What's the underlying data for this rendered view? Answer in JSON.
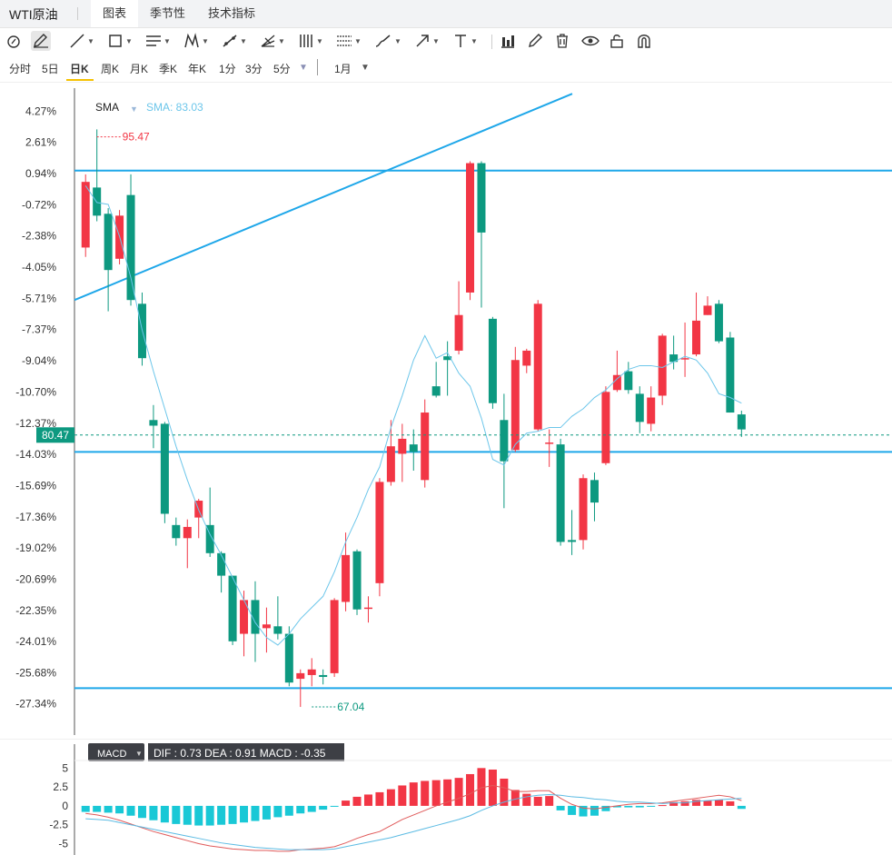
{
  "header": {
    "title": "WTI原油",
    "tabs": [
      {
        "label": "图表",
        "active": true
      },
      {
        "label": "季节性",
        "active": false
      },
      {
        "label": "技术指标",
        "active": false
      }
    ]
  },
  "toolbar": {
    "tools": [
      "cursor-icon",
      "pen-icon",
      "line-icon",
      "rectangle-icon",
      "channel-icon",
      "pattern-icon",
      "fib-icon",
      "gann-icon",
      "hlines-icon",
      "grid-lines-icon",
      "brush-icon",
      "arrow-icon",
      "text-icon",
      "bar-chart-icon",
      "edit-icon",
      "trash-icon",
      "eye-icon",
      "lock-icon",
      "magnet-icon"
    ]
  },
  "periods": {
    "items": [
      "分时",
      "5日",
      "日K",
      "周K",
      "月K",
      "季K",
      "年K",
      "1分",
      "3分",
      "5分"
    ],
    "active": "日K",
    "range": "1月"
  },
  "chart_data": {
    "type": "candlestick",
    "indicator_label": "SMA",
    "sma_readout": "SMA: 83.03",
    "y_axis_ticks": [
      "4.27%",
      "2.61%",
      "0.94%",
      "-0.72%",
      "-2.38%",
      "-4.05%",
      "-5.71%",
      "-7.37%",
      "-9.04%",
      "-10.70%",
      "-12.37%",
      "-14.03%",
      "-15.69%",
      "-17.36%",
      "-19.02%",
      "-20.69%",
      "-22.35%",
      "-24.01%",
      "-25.68%",
      "-27.34%"
    ],
    "y_range_pct": [
      -29.0,
      5.5
    ],
    "current_price": "80.47",
    "current_price_pct": -13.0,
    "high_label": "95.47",
    "high_pct": 2.9,
    "low_label": "67.04",
    "low_pct": -27.5,
    "candles": [
      {
        "o": -3.0,
        "c": 0.5,
        "h": 0.9,
        "l": -3.5
      },
      {
        "o": 0.2,
        "c": -1.3,
        "h": 3.3,
        "l": -1.6
      },
      {
        "o": -1.2,
        "c": -4.2,
        "h": -0.9,
        "l": -6.4
      },
      {
        "o": -3.6,
        "c": -1.3,
        "h": -1.0,
        "l": -3.9
      },
      {
        "o": -0.2,
        "c": -5.8,
        "h": 0.9,
        "l": -6.1
      },
      {
        "o": -6.0,
        "c": -8.9,
        "h": -5.4,
        "l": -9.3
      },
      {
        "o": -12.2,
        "c": -12.5,
        "h": -11.4,
        "l": -13.7
      },
      {
        "o": -12.4,
        "c": -17.2,
        "h": -12.3,
        "l": -17.7
      },
      {
        "o": -17.8,
        "c": -18.5,
        "h": -17.4,
        "l": -18.9
      },
      {
        "o": -18.5,
        "c": -17.9,
        "h": -17.5,
        "l": -20.1
      },
      {
        "o": -17.4,
        "c": -16.5,
        "h": -16.4,
        "l": -18.5
      },
      {
        "o": -17.8,
        "c": -19.3,
        "h": -15.8,
        "l": -19.5
      },
      {
        "o": -19.3,
        "c": -20.5,
        "h": -19.2,
        "l": -21.4
      },
      {
        "o": -20.5,
        "c": -24.0,
        "h": -20.5,
        "l": -24.2
      },
      {
        "o": -23.6,
        "c": -21.8,
        "h": -21.3,
        "l": -24.8
      },
      {
        "o": -21.8,
        "c": -23.6,
        "h": -20.8,
        "l": -25.1
      },
      {
        "o": -23.3,
        "c": -23.1,
        "h": -22.2,
        "l": -24.6
      },
      {
        "o": -23.2,
        "c": -23.6,
        "h": -21.6,
        "l": -23.9
      },
      {
        "o": -23.6,
        "c": -26.2,
        "h": -23.2,
        "l": -26.4
      },
      {
        "o": -26.0,
        "c": -25.7,
        "h": -25.5,
        "l": -27.5
      },
      {
        "o": -25.8,
        "c": -25.5,
        "h": -24.9,
        "l": -26.4
      },
      {
        "o": -25.8,
        "c": -25.9,
        "h": -25.5,
        "l": -26.3
      },
      {
        "o": -25.7,
        "c": -21.8,
        "h": -21.7,
        "l": -25.9
      },
      {
        "o": -21.9,
        "c": -19.4,
        "h": -18.2,
        "l": -22.4
      },
      {
        "o": -19.2,
        "c": -22.3,
        "h": -19.1,
        "l": -22.6
      },
      {
        "o": -22.2,
        "c": -22.2,
        "h": -21.6,
        "l": -23.0
      },
      {
        "o": -20.9,
        "c": -15.5,
        "h": -15.3,
        "l": -21.6
      },
      {
        "o": -15.5,
        "c": -13.6,
        "h": -12.2,
        "l": -15.7
      },
      {
        "o": -14.0,
        "c": -13.2,
        "h": -12.4,
        "l": -15.5
      },
      {
        "o": -13.5,
        "c": -13.9,
        "h": -12.7,
        "l": -14.9
      },
      {
        "o": -15.4,
        "c": -11.8,
        "h": -11.1,
        "l": -15.8
      },
      {
        "o": -10.4,
        "c": -10.9,
        "h": -9.1,
        "l": -11.0
      },
      {
        "o": -8.8,
        "c": -9.0,
        "h": -8.0,
        "l": -10.9
      },
      {
        "o": -8.5,
        "c": -6.6,
        "h": -4.8,
        "l": -8.7
      },
      {
        "o": -5.4,
        "c": 1.5,
        "h": 1.6,
        "l": -5.8
      },
      {
        "o": 1.5,
        "c": -2.2,
        "h": 1.6,
        "l": -6.2
      },
      {
        "o": -6.8,
        "c": -11.3,
        "h": -6.7,
        "l": -11.6
      },
      {
        "o": -12.2,
        "c": -14.4,
        "h": -10.8,
        "l": -16.9
      },
      {
        "o": -13.8,
        "c": -9.0,
        "h": -8.3,
        "l": -13.9
      },
      {
        "o": -9.3,
        "c": -8.5,
        "h": -8.4,
        "l": -9.7
      },
      {
        "o": -12.7,
        "c": -6.0,
        "h": -5.8,
        "l": -12.8
      },
      {
        "o": -13.4,
        "c": -13.4,
        "h": -12.7,
        "l": -14.7
      },
      {
        "o": -13.5,
        "c": -18.7,
        "h": -13.2,
        "l": -18.9
      },
      {
        "o": -18.6,
        "c": -18.7,
        "h": -17.0,
        "l": -19.4
      },
      {
        "o": -18.6,
        "c": -15.3,
        "h": -15.1,
        "l": -19.1
      },
      {
        "o": -15.4,
        "c": -16.6,
        "h": -15.0,
        "l": -17.6
      },
      {
        "o": -14.5,
        "c": -10.7,
        "h": -10.4,
        "l": -14.6
      },
      {
        "o": -10.6,
        "c": -9.8,
        "h": -8.5,
        "l": -10.7
      },
      {
        "o": -9.6,
        "c": -10.6,
        "h": -9.1,
        "l": -10.8
      },
      {
        "o": -10.8,
        "c": -12.3,
        "h": -10.4,
        "l": -12.9
      },
      {
        "o": -12.4,
        "c": -11.0,
        "h": -10.4,
        "l": -12.8
      },
      {
        "o": -10.9,
        "c": -7.7,
        "h": -7.6,
        "l": -11.4
      },
      {
        "o": -8.7,
        "c": -9.1,
        "h": -7.7,
        "l": -9.5
      },
      {
        "o": -8.9,
        "c": -8.9,
        "h": -7.0,
        "l": -9.9
      },
      {
        "o": -8.7,
        "c": -6.9,
        "h": -5.4,
        "l": -8.8
      },
      {
        "o": -6.6,
        "c": -6.1,
        "h": -5.6,
        "l": -6.6
      },
      {
        "o": -6.0,
        "c": -8.0,
        "h": -5.8,
        "l": -8.1
      },
      {
        "o": -7.8,
        "c": -11.8,
        "h": -7.5,
        "l": -11.8
      },
      {
        "o": -11.9,
        "c": -12.7,
        "h": -11.7,
        "l": -13.1
      }
    ],
    "sma": [
      0.3,
      -0.6,
      -0.7,
      -2.4,
      -4.6,
      -7.4,
      -9.6,
      -11.6,
      -13.6,
      -15.4,
      -17.0,
      -18.3,
      -19.4,
      -20.6,
      -21.8,
      -23.0,
      -23.8,
      -24.2,
      -23.6,
      -22.8,
      -22.2,
      -21.6,
      -20.3,
      -18.7,
      -17.4,
      -15.9,
      -14.7,
      -12.6,
      -10.9,
      -9.0,
      -7.7,
      -8.9,
      -8.6,
      -9.7,
      -10.4,
      -12.1,
      -14.3,
      -14.6,
      -13.5,
      -12.9,
      -12.8,
      -12.6,
      -12.6,
      -12.0,
      -11.6,
      -11.0,
      -10.6,
      -10.0,
      -9.5,
      -9.3,
      -9.3,
      -9.4,
      -9.1,
      -8.8,
      -9.0,
      -9.7,
      -10.8,
      -11.0,
      -11.3
    ],
    "annotations": {
      "hlines_pct": [
        1.1,
        -13.9,
        -26.5
      ],
      "trendline_pct": {
        "from": -5.8,
        "to": 5.2
      }
    },
    "macd": {
      "label": "MACD",
      "readout": "DIF : 0.73  DEA : 0.91  MACD : -0.35",
      "y_ticks": [
        "5",
        "2.5",
        "0",
        "-2.5",
        "-5"
      ],
      "y_range": [
        -6.5,
        6
      ],
      "hist": [
        -0.8,
        -0.8,
        -0.9,
        -1.0,
        -1.3,
        -1.6,
        -1.9,
        -2.2,
        -2.4,
        -2.5,
        -2.6,
        -2.6,
        -2.5,
        -2.4,
        -2.2,
        -2.0,
        -1.8,
        -1.5,
        -1.3,
        -1.0,
        -0.8,
        -0.5,
        -0.1,
        0.7,
        1.2,
        1.5,
        1.8,
        2.2,
        2.7,
        3.1,
        3.3,
        3.4,
        3.5,
        3.7,
        4.2,
        5.0,
        4.8,
        3.6,
        2.1,
        1.6,
        1.2,
        1.3,
        -0.6,
        -1.2,
        -1.4,
        -1.3,
        -0.7,
        -0.2,
        -0.2,
        -0.2,
        -0.1,
        0.1,
        0.5,
        0.6,
        0.8,
        0.7,
        0.8,
        0.6,
        -0.4
      ],
      "dif": [
        -1.0,
        -1.2,
        -1.5,
        -1.9,
        -2.4,
        -2.9,
        -3.4,
        -3.8,
        -4.2,
        -4.6,
        -5.0,
        -5.3,
        -5.5,
        -5.7,
        -5.8,
        -5.9,
        -5.9,
        -6.0,
        -6.0,
        -5.8,
        -5.7,
        -5.6,
        -5.4,
        -4.9,
        -4.3,
        -3.8,
        -3.4,
        -2.6,
        -1.8,
        -1.2,
        -0.6,
        0.0,
        0.5,
        1.0,
        1.6,
        2.4,
        2.7,
        2.4,
        1.9,
        1.9,
        2.0,
        2.0,
        1.0,
        0.2,
        -0.3,
        -0.4,
        -0.2,
        0.0,
        0.2,
        0.3,
        0.3,
        0.4,
        0.6,
        0.8,
        1.0,
        1.2,
        1.4,
        1.2,
        0.7
      ],
      "dea": [
        -1.7,
        -1.8,
        -1.9,
        -2.2,
        -2.5,
        -2.8,
        -3.1,
        -3.4,
        -3.7,
        -4.0,
        -4.3,
        -4.6,
        -4.9,
        -5.1,
        -5.3,
        -5.5,
        -5.6,
        -5.7,
        -5.8,
        -5.8,
        -5.8,
        -5.8,
        -5.7,
        -5.4,
        -5.1,
        -4.8,
        -4.5,
        -4.2,
        -3.8,
        -3.4,
        -3.0,
        -2.6,
        -2.2,
        -1.8,
        -1.3,
        -0.6,
        0.0,
        0.5,
        0.9,
        1.2,
        1.4,
        1.5,
        1.4,
        1.2,
        1.1,
        0.9,
        0.8,
        0.6,
        0.5,
        0.5,
        0.4,
        0.3,
        0.4,
        0.4,
        0.6,
        0.7,
        0.8,
        0.9,
        1.0
      ]
    }
  },
  "colors": {
    "up": "#f23645",
    "down": "#0d9980",
    "accent": "#1ea7e9",
    "sma": "#6cc6ea",
    "macd_pos": "#f23645",
    "macd_neg": "#19c8d6"
  }
}
